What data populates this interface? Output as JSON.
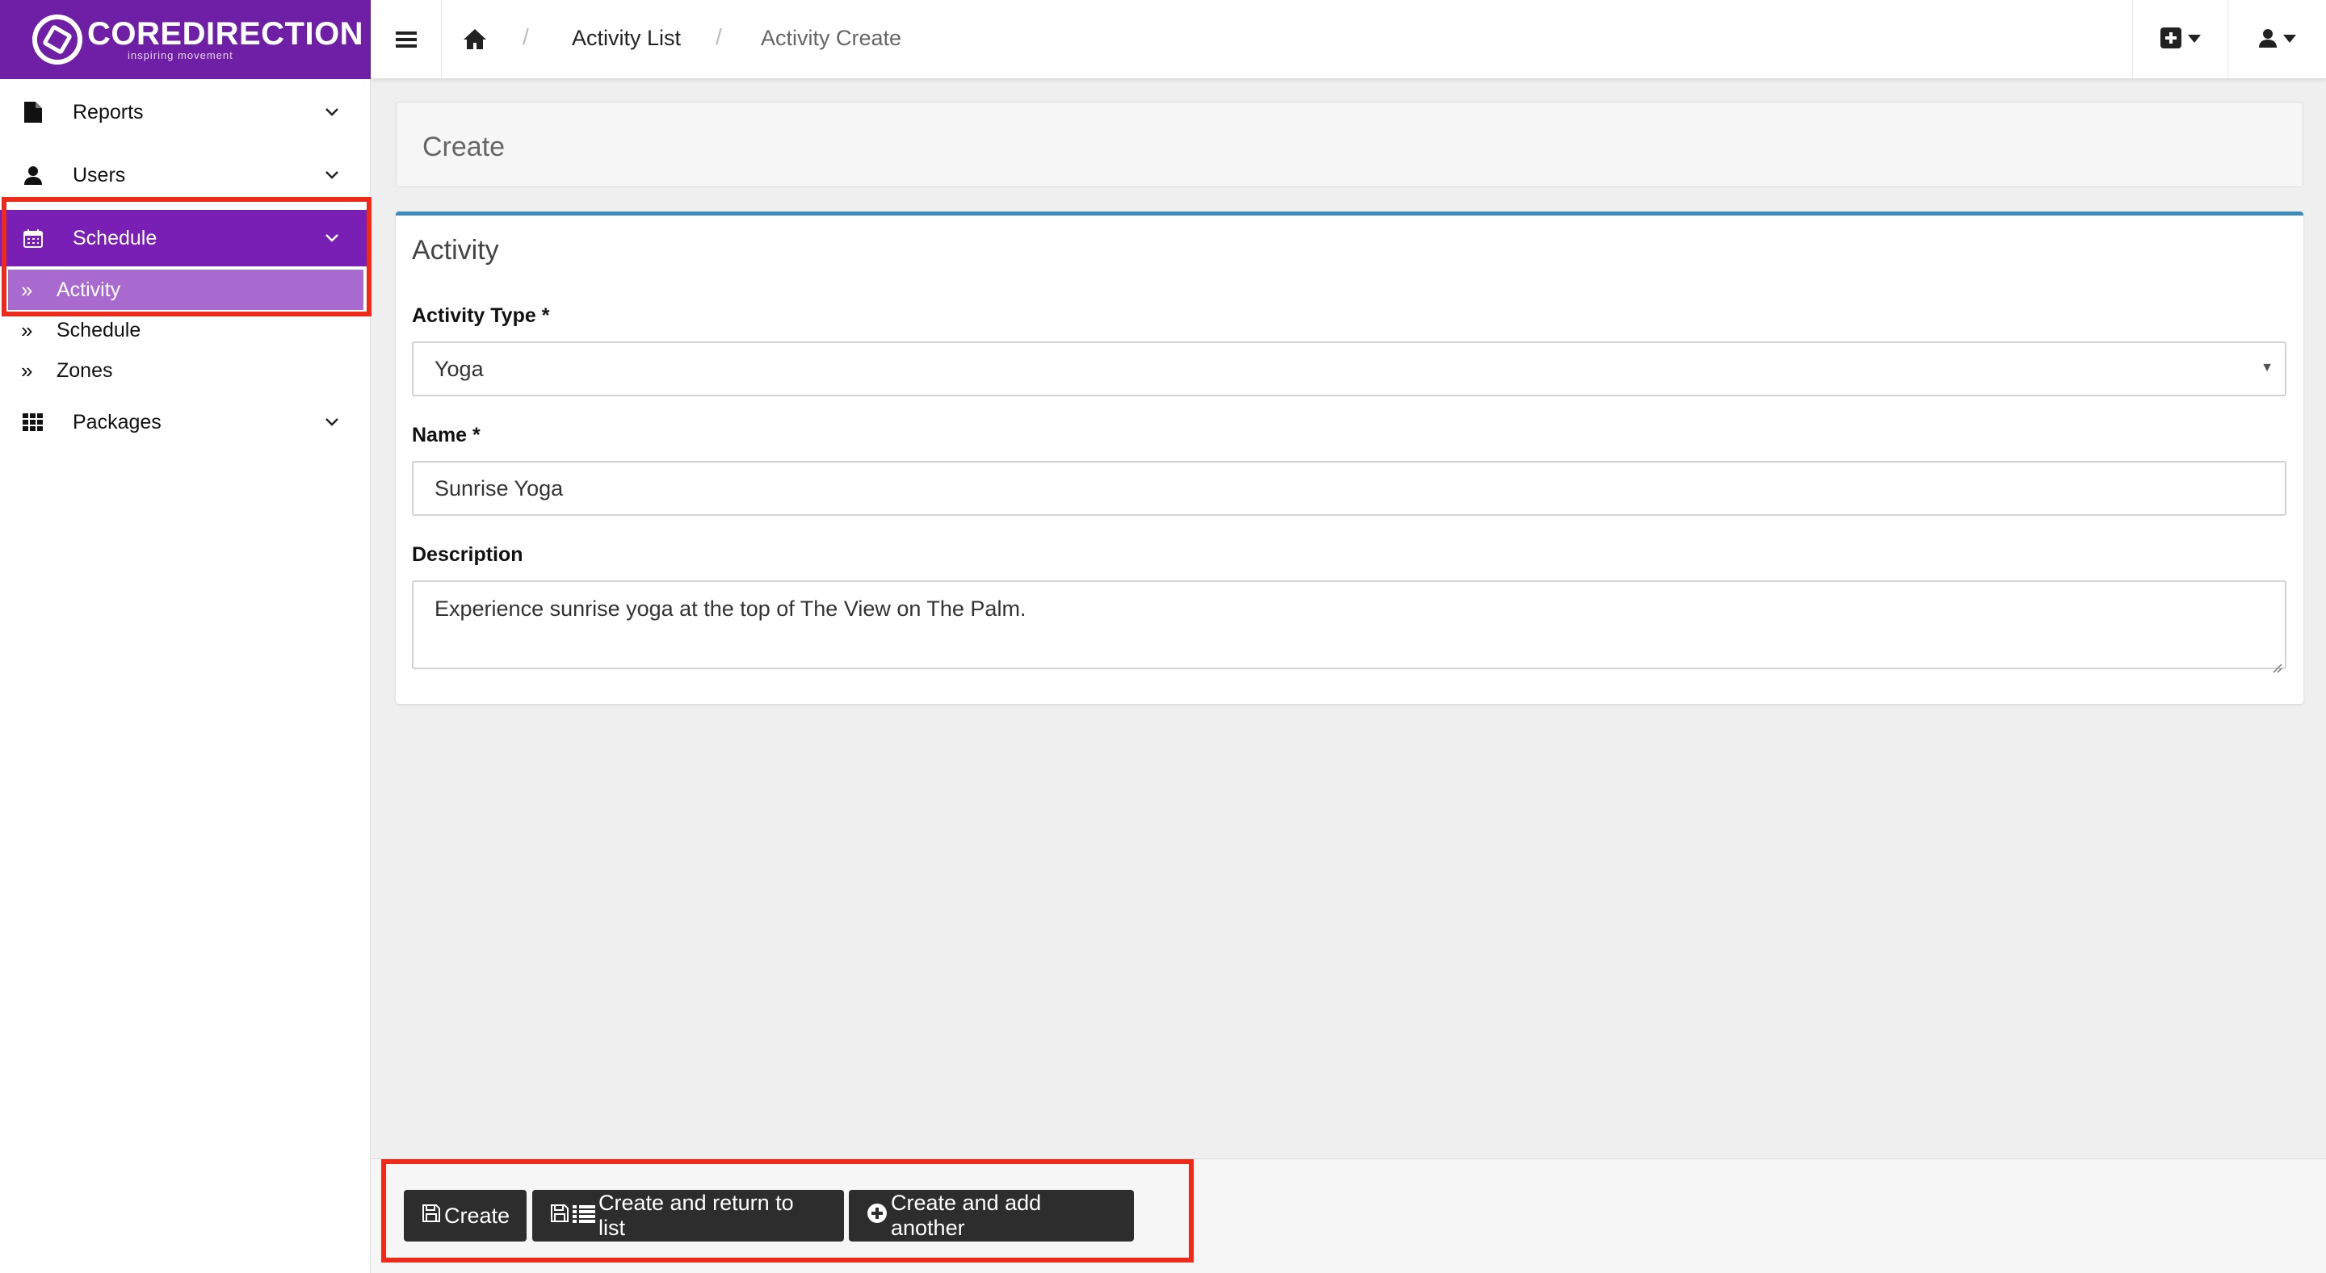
{
  "brand": {
    "name": "COREDIRECTION",
    "tagline": "inspiring movement",
    "color": "#6f1ea6"
  },
  "sidebar": {
    "items": [
      {
        "label": "Reports",
        "icon": "file-icon"
      },
      {
        "label": "Users",
        "icon": "user-icon"
      },
      {
        "label": "Schedule",
        "icon": "calendar-icon",
        "active": true,
        "children": [
          {
            "label": "Activity",
            "active": true
          },
          {
            "label": "Schedule"
          },
          {
            "label": "Zones"
          }
        ]
      },
      {
        "label": "Packages",
        "icon": "grid-icon"
      }
    ]
  },
  "topbar": {
    "breadcrumb": {
      "list": "Activity List",
      "current": "Activity Create"
    }
  },
  "header": {
    "title": "Create"
  },
  "form": {
    "box_title": "Activity",
    "activity_type": {
      "label": "Activity Type *",
      "value": "Yoga"
    },
    "name": {
      "label": "Name *",
      "value": "Sunrise Yoga"
    },
    "description": {
      "label": "Description",
      "value": "Experience sunrise yoga at the top of The View on The Palm."
    }
  },
  "actions": {
    "create": "Create",
    "create_return": "Create and return to list",
    "create_another": "Create and add another"
  },
  "colors": {
    "accent": "#7a1fb5",
    "active_child": "#a96ad0",
    "box_border": "#3c8dbc",
    "highlight": "#ee2a1b",
    "button": "#2d2d2d"
  }
}
